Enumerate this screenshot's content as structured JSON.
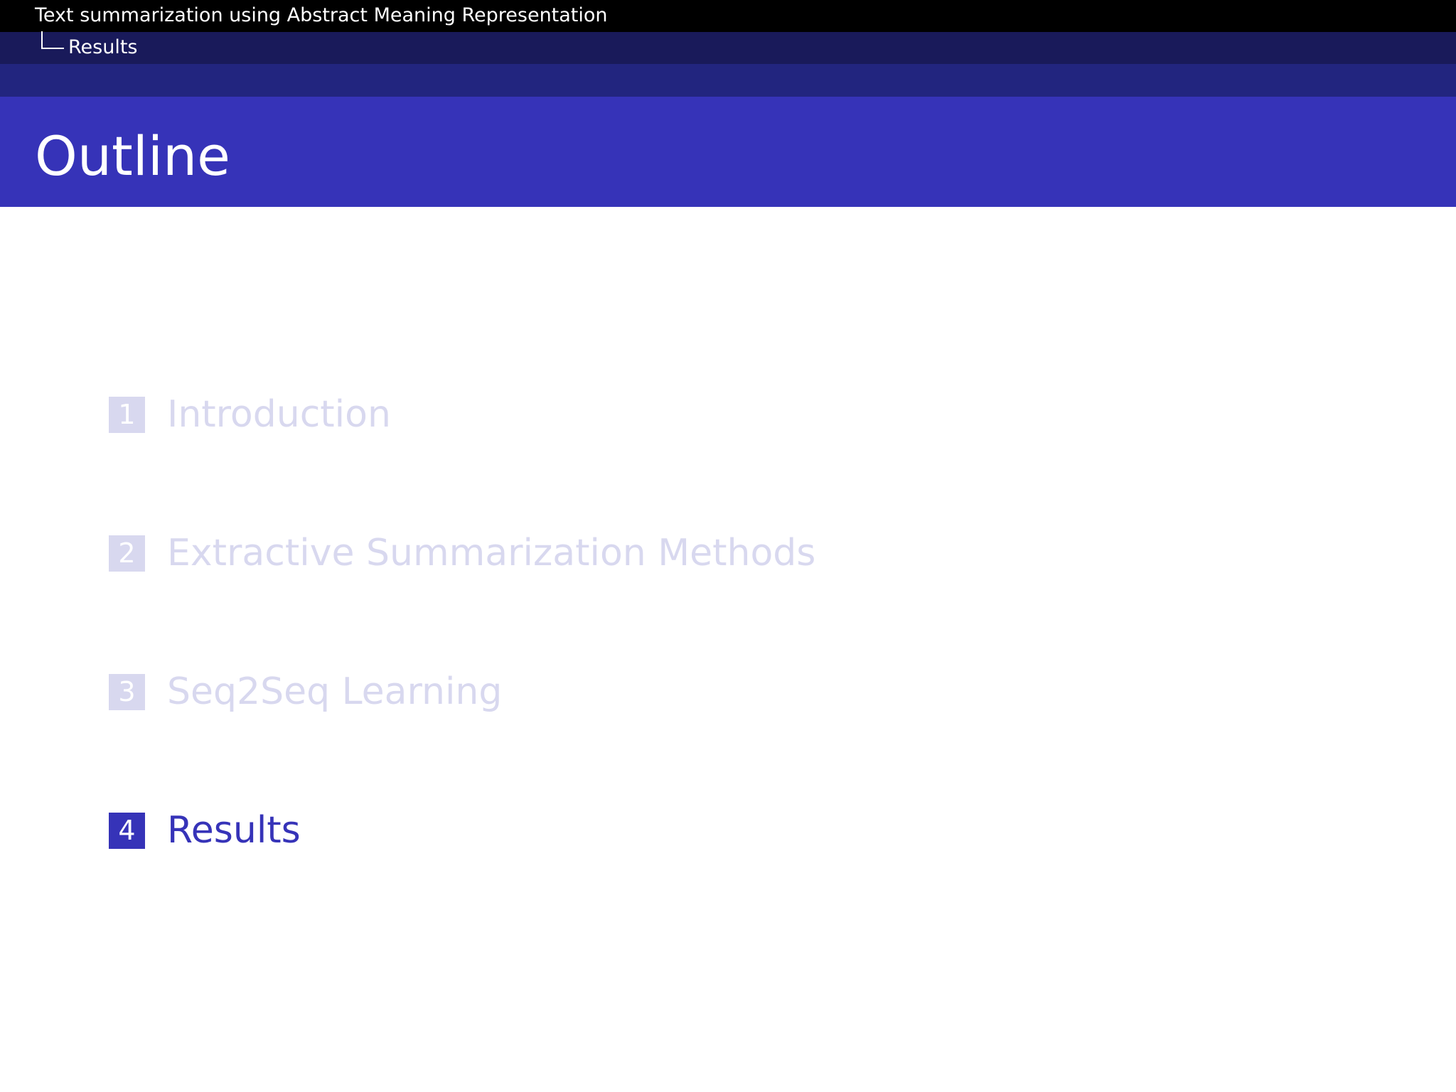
{
  "header": {
    "presentation_title": "Text summarization using Abstract Meaning Representation",
    "current_section": "Results"
  },
  "frame": {
    "title": "Outline"
  },
  "outline": {
    "items": [
      {
        "number": "1",
        "label": "Introduction",
        "state": "inactive"
      },
      {
        "number": "2",
        "label": "Extractive Summarization Methods",
        "state": "inactive"
      },
      {
        "number": "3",
        "label": "Seq2Seq Learning",
        "state": "inactive"
      },
      {
        "number": "4",
        "label": "Results",
        "state": "active"
      }
    ]
  },
  "colors": {
    "headline_bar": "#000000",
    "subsection_bar": "#191a5a",
    "spacer_bar": "#22257f",
    "title_bar": "#3633b8",
    "active_item": "#3633b8",
    "inactive_item": "#d8d8ef"
  }
}
